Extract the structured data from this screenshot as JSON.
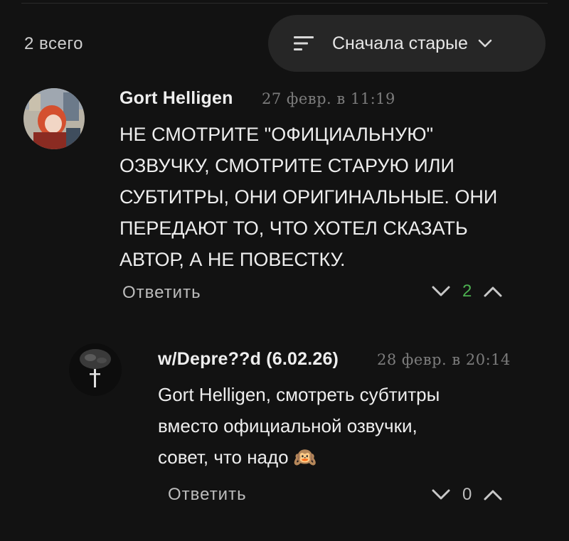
{
  "header": {
    "total": "2 всего",
    "sort_label": "Сначала старые"
  },
  "comments": [
    {
      "author": "Gort Helligen",
      "date": "27 февр. в 11:19",
      "lines": [
        "НЕ СМОТРИТЕ \"ОФИЦИАЛЬНУЮ\"",
        "ОЗВУЧКУ, СМОТРИТЕ СТАРУЮ ИЛИ",
        "СУБТИТРЫ, ОНИ ОРИГИНАЛЬНЫЕ. ОНИ",
        "ПЕРЕДАЮТ ТО, ЧТО ХОТЕЛ СКАЗАТЬ",
        "АВТОР, А НЕ ПОВЕСТКУ."
      ],
      "reply_label": "Ответить",
      "score": "2",
      "score_color": "#4caf50"
    },
    {
      "author": "w/Depre??d (6.02.26)",
      "date": "28 февр. в 20:14",
      "lines": [
        "Gort Helligen, смотреть субтитры",
        "вместо официальной озвучки,",
        "совет, что надо 🙉"
      ],
      "reply_label": "Ответить",
      "score": "0",
      "score_color": "#bdbdbd"
    }
  ],
  "icons": {
    "sort": "sort-lines-icon",
    "chevron": "chevron-down-icon",
    "downvote": "chevron-down-icon",
    "upvote": "chevron-up-icon"
  }
}
